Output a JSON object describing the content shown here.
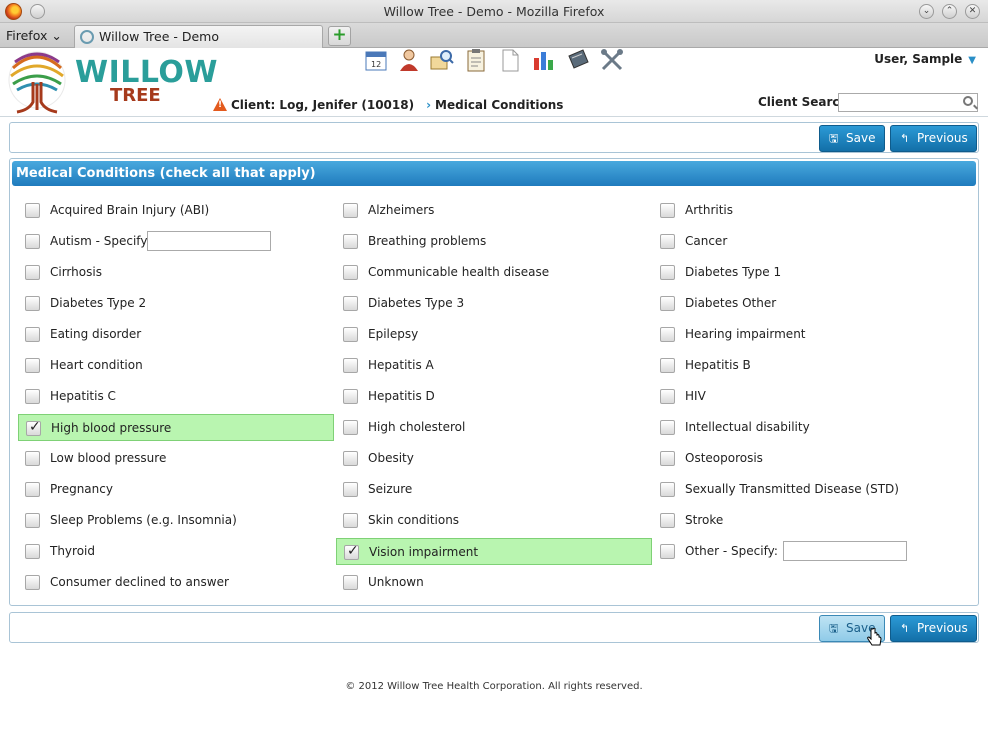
{
  "window": {
    "title": "Willow Tree - Demo - Mozilla Firefox",
    "firefox_menu": "Firefox",
    "tab_label": "Willow Tree - Demo",
    "new_tab_icon": "plus-icon"
  },
  "brand": {
    "line1": "WILLOW",
    "line2": "TREE"
  },
  "toolbar": {
    "icons": [
      "calendar-icon",
      "client-icon",
      "search-records-icon",
      "clipboard-icon",
      "document-icon",
      "chart-icon",
      "notebook-icon",
      "tools-icon"
    ]
  },
  "user": {
    "name": "User, Sample"
  },
  "breadcrumb": {
    "client": "Client: Log, Jenifer (10018)",
    "page": "Medical Conditions"
  },
  "search": {
    "label": "Client Search",
    "value": ""
  },
  "buttons": {
    "save": "Save",
    "previous": "Previous"
  },
  "panel": {
    "title": "Medical Conditions (check all that apply)"
  },
  "conditions": [
    {
      "label": "Acquired Brain Injury (ABI)",
      "checked": false
    },
    {
      "label": "Alzheimers",
      "checked": false
    },
    {
      "label": "Arthritis",
      "checked": false
    },
    {
      "label": "Autism - Specify:",
      "checked": false,
      "specify": ""
    },
    {
      "label": "Breathing problems",
      "checked": false
    },
    {
      "label": "Cancer",
      "checked": false
    },
    {
      "label": "Cirrhosis",
      "checked": false
    },
    {
      "label": "Communicable health disease",
      "checked": false
    },
    {
      "label": "Diabetes Type 1",
      "checked": false
    },
    {
      "label": "Diabetes Type 2",
      "checked": false
    },
    {
      "label": "Diabetes Type 3",
      "checked": false
    },
    {
      "label": "Diabetes Other",
      "checked": false
    },
    {
      "label": "Eating disorder",
      "checked": false
    },
    {
      "label": "Epilepsy",
      "checked": false
    },
    {
      "label": "Hearing impairment",
      "checked": false
    },
    {
      "label": "Heart condition",
      "checked": false
    },
    {
      "label": "Hepatitis A",
      "checked": false
    },
    {
      "label": "Hepatitis B",
      "checked": false
    },
    {
      "label": "Hepatitis C",
      "checked": false
    },
    {
      "label": "Hepatitis D",
      "checked": false
    },
    {
      "label": "HIV",
      "checked": false
    },
    {
      "label": "High blood pressure",
      "checked": true
    },
    {
      "label": "High cholesterol",
      "checked": false
    },
    {
      "label": "Intellectual disability",
      "checked": false
    },
    {
      "label": "Low blood pressure",
      "checked": false
    },
    {
      "label": "Obesity",
      "checked": false
    },
    {
      "label": "Osteoporosis",
      "checked": false
    },
    {
      "label": "Pregnancy",
      "checked": false
    },
    {
      "label": "Seizure",
      "checked": false
    },
    {
      "label": "Sexually Transmitted Disease (STD)",
      "checked": false
    },
    {
      "label": "Sleep Problems (e.g. Insomnia)",
      "checked": false
    },
    {
      "label": "Skin conditions",
      "checked": false
    },
    {
      "label": "Stroke",
      "checked": false
    },
    {
      "label": "Thyroid",
      "checked": false
    },
    {
      "label": "Vision impairment",
      "checked": true
    },
    {
      "label": "Other - Specify:",
      "checked": false,
      "specify": ""
    },
    {
      "label": "Consumer declined to answer",
      "checked": false
    },
    {
      "label": "Unknown",
      "checked": false
    }
  ],
  "footer": "© 2012 Willow Tree Health Corporation. All rights reserved.",
  "colors": {
    "accent": "#1f7bbd",
    "checked_bg": "#b9f5b0",
    "brand_teal": "#2a9e9a",
    "brand_red": "#a63a1c"
  }
}
